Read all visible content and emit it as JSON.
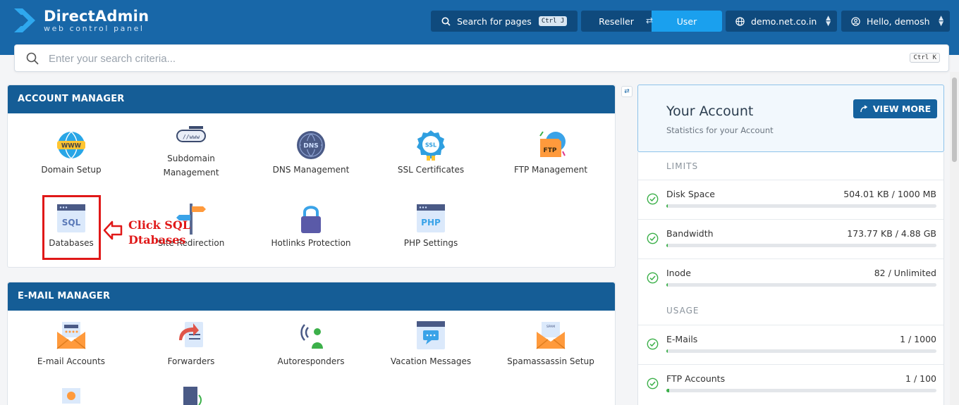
{
  "header": {
    "logo_title": "DirectAdmin",
    "logo_subtitle": "web control panel",
    "search_pages": {
      "label": "Search for pages",
      "shortcut": "Ctrl J"
    },
    "role_switch": {
      "reseller": "Reseller",
      "user": "User",
      "active": "User"
    },
    "domain": "demo.net.co.in",
    "greeting": "Hello, demosh"
  },
  "search": {
    "placeholder": "Enter your search criteria...",
    "shortcut": "Ctrl K"
  },
  "account_manager": {
    "title": "ACCOUNT MANAGER",
    "items": [
      {
        "label": "Domain Setup",
        "icon": "www-globe-icon"
      },
      {
        "label": "Subdomain Management",
        "icon": "subdomain-icon"
      },
      {
        "label": "DNS Management",
        "icon": "dns-globe-icon"
      },
      {
        "label": "SSL Certificates",
        "icon": "ssl-badge-icon"
      },
      {
        "label": "FTP Management",
        "icon": "ftp-icon"
      },
      {
        "label": "Databases",
        "icon": "sql-database-icon"
      },
      {
        "label": "Site Redirection",
        "icon": "signpost-icon"
      },
      {
        "label": "Hotlinks Protection",
        "icon": "padlock-icon"
      },
      {
        "label": "PHP Settings",
        "icon": "php-window-icon"
      }
    ]
  },
  "annotation": {
    "line1": "Click SQL",
    "line2": "Dtabases"
  },
  "email_manager": {
    "title": "E-MAIL MANAGER",
    "items": [
      {
        "label": "E-mail Accounts",
        "icon": "envelope-icon"
      },
      {
        "label": "Forwarders",
        "icon": "forward-document-icon"
      },
      {
        "label": "Autoresponders",
        "icon": "auto-signal-person-icon"
      },
      {
        "label": "Vacation Messages",
        "icon": "vacation-message-icon"
      },
      {
        "label": "Spamassassin Setup",
        "icon": "spam-envelope-icon"
      }
    ]
  },
  "your_account": {
    "title": "Your Account",
    "subtitle": "Statistics for your Account",
    "view_more": "VIEW MORE",
    "limits_heading": "LIMITS",
    "usage_heading": "USAGE",
    "limits": [
      {
        "name": "Disk Space",
        "value": "504.01 KB / 1000 MB",
        "fraction": 0.0005
      },
      {
        "name": "Bandwidth",
        "value": "173.77 KB / 4.88 GB",
        "fraction": 3e-05
      },
      {
        "name": "Inode",
        "value": "82 / Unlimited",
        "fraction": 0.0
      }
    ],
    "usage": [
      {
        "name": "E-Mails",
        "value": "1 / 1000",
        "fraction": 0.001
      },
      {
        "name": "FTP Accounts",
        "value": "1 / 100",
        "fraction": 0.01
      }
    ]
  },
  "colors": {
    "header": "#1867a8",
    "panel_head": "#155d96",
    "accent": "#1aa0ee",
    "annotation": "#e01818",
    "ok": "#3cb04a"
  }
}
